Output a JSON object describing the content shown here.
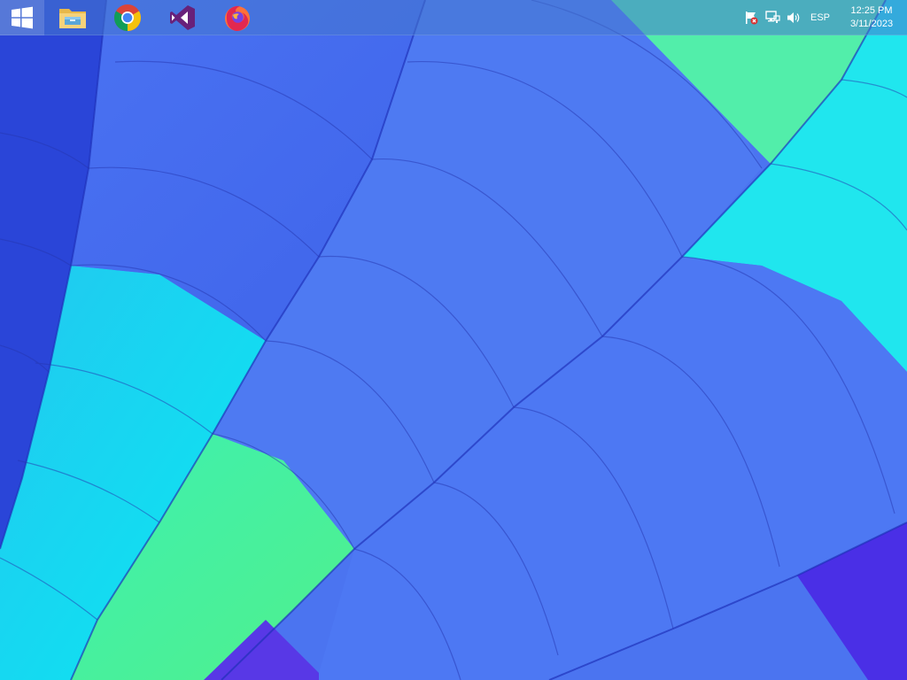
{
  "taskbar": {
    "apps": [
      {
        "name": "File Explorer",
        "icon": "folder-icon"
      },
      {
        "name": "Google Chrome",
        "icon": "chrome-icon"
      },
      {
        "name": "Visual Studio",
        "icon": "visual-studio-icon"
      },
      {
        "name": "Firefox",
        "icon": "firefox-icon"
      }
    ],
    "tray": {
      "icons": [
        "action-center-flag-icon",
        "network-icon",
        "volume-icon"
      ],
      "language": "ESP",
      "time": "12:25 PM",
      "date": "3/11/2023"
    }
  },
  "colors": {
    "taskbar": "#4678cd",
    "panel_blue": "#4f78f0",
    "panel_cyan": "#10e0f0",
    "panel_green": "#40f0a0",
    "panel_violet": "#5a30e8"
  }
}
